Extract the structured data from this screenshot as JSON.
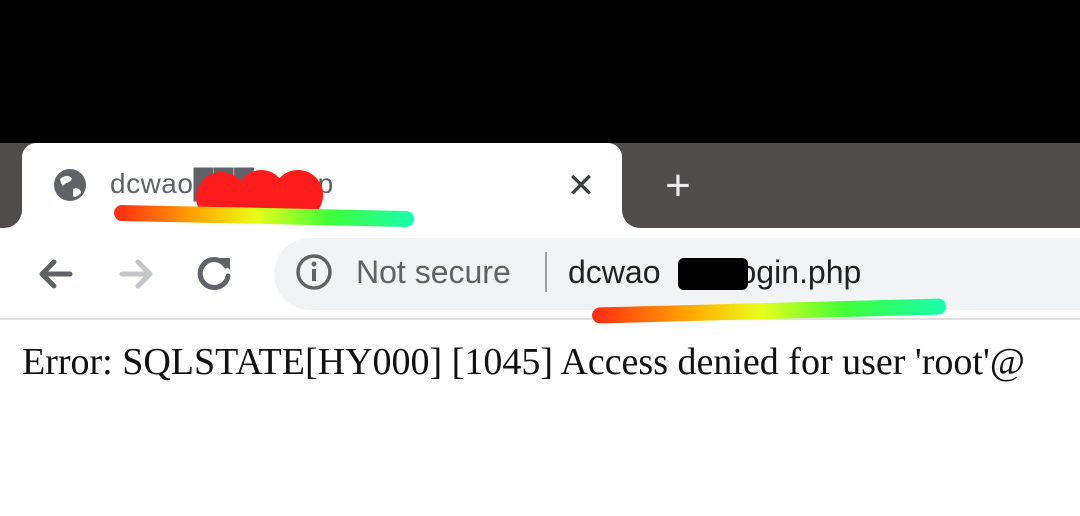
{
  "browser": {
    "tab": {
      "title": "dcwao███in.php",
      "close_icon": "✕"
    },
    "new_tab_icon": "+",
    "nav": {
      "back_icon": "back-arrow-icon",
      "forward_icon": "forward-arrow-icon",
      "reload_icon": "reload-icon"
    },
    "address_bar": {
      "security_label": "Not secure",
      "url_prefix": "dcwao",
      "url_suffix": "/login.php"
    }
  },
  "page": {
    "error_text": "Error: SQLSTATE[HY000] [1045] Access denied for user 'root'@"
  }
}
